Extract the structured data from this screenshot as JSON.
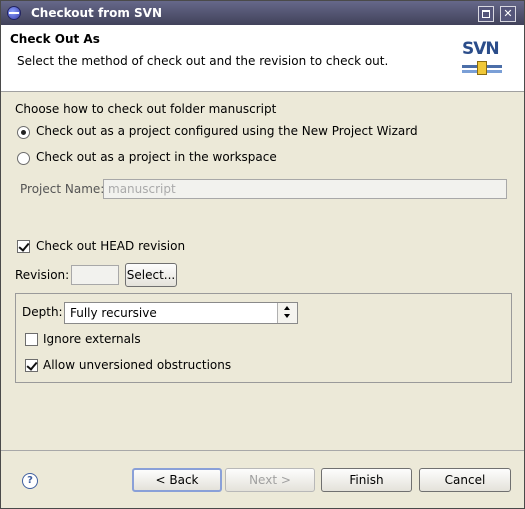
{
  "window": {
    "title": "Checkout from SVN"
  },
  "header": {
    "title": "Check Out As",
    "description": "Select the method of check out and the revision to check out.",
    "logo_text": "SVN"
  },
  "checkout": {
    "prompt": "Choose how to check out folder manuscript",
    "option_wizard": "Check out as a project configured using the New Project Wizard",
    "option_workspace": "Check out as a project in the workspace",
    "selected_option": "option_wizard",
    "project_name_label": "Project Name:",
    "project_name_value": "manuscript"
  },
  "revision": {
    "head_label": "Check out HEAD revision",
    "head_checked": true,
    "revision_label": "Revision:",
    "revision_value": "",
    "select_button": "Select..."
  },
  "options": {
    "depth_label": "Depth:",
    "depth_value": "Fully recursive",
    "ignore_externals_label": "Ignore externals",
    "ignore_externals_checked": false,
    "allow_unversioned_label": "Allow unversioned obstructions",
    "allow_unversioned_checked": true
  },
  "footer": {
    "help_icon": "?",
    "back_button": "< Back",
    "next_button": "Next >",
    "finish_button": "Finish",
    "cancel_button": "Cancel"
  }
}
